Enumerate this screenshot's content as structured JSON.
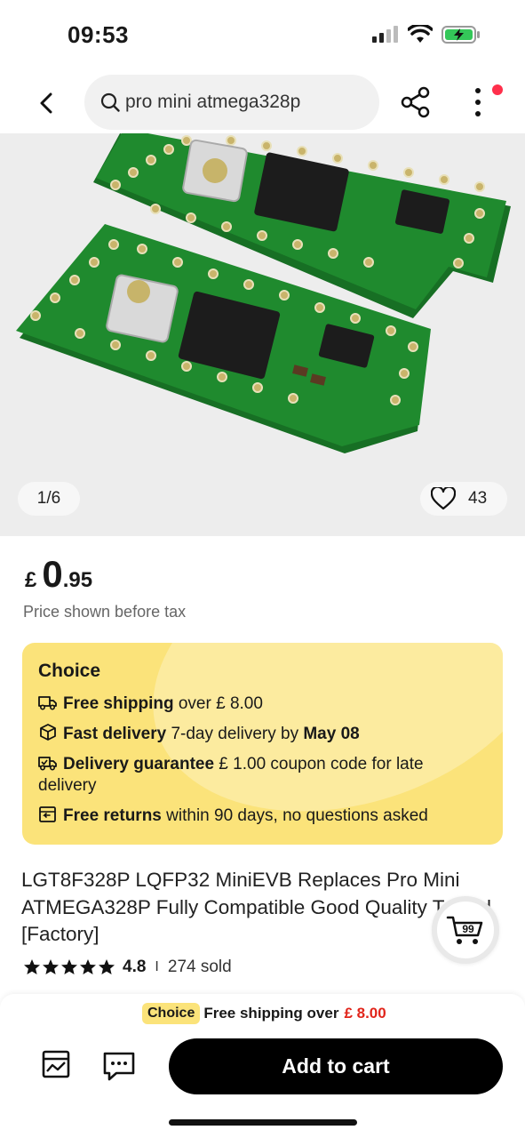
{
  "status_bar": {
    "time": "09:53"
  },
  "header": {
    "search_text": "pro mini atmega328p"
  },
  "gallery": {
    "counter": "1/6",
    "wishlist_count": "43"
  },
  "price": {
    "currency": "£",
    "integer": "0",
    "decimal": ".95",
    "note": "Price shown before tax"
  },
  "choice": {
    "title": "Choice",
    "rows": [
      {
        "bold": "Free shipping",
        "text": " over  £ 8.00",
        "icon": "truck-icon"
      },
      {
        "bold": "Fast delivery",
        "text": " 7-day delivery by ",
        "bold2": "May 08",
        "icon": "box-icon"
      },
      {
        "bold": "Delivery guarantee",
        "text": "  £ 1.00 coupon code for late delivery",
        "icon": "truck-check-icon"
      },
      {
        "bold": "Free returns",
        "text": "  within 90 days, no questions asked",
        "icon": "return-icon"
      }
    ]
  },
  "product": {
    "title": "LGT8F328P LQFP32 MiniEVB Replaces Pro Mini ATMEGA328P Fully Compatible Good Quality Tested [Factory]",
    "rating": "4.8",
    "separator": "I",
    "sold": "274 sold",
    "badge": "99"
  },
  "bottom": {
    "chip": "Choice",
    "shipping_text": "Free shipping over",
    "shipping_amount": "£ 8.00",
    "add_to_cart": "Add to cart"
  },
  "colors": {
    "choice_yellow": "#fbe37a",
    "price_red": "#e1251b",
    "notif_red": "#ff2f4b",
    "pcb_green": "#1f8a2e"
  }
}
